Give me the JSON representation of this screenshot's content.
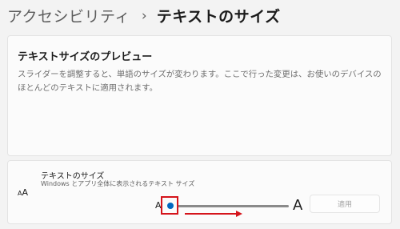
{
  "breadcrumb": {
    "parent": "アクセシビリティ",
    "separator": "›",
    "current": "テキストのサイズ"
  },
  "preview": {
    "title": "テキストサイズのプレビュー",
    "body": "スライダーを調整すると、単語のサイズが変わります。ここで行った変更は、お使いのデバイスのほとんどのテキストに適用されます。"
  },
  "text_size": {
    "icon_small": "A",
    "icon_big": "A",
    "title": "テキストのサイズ",
    "subtitle": "Windows とアプリ全体に表示されるテキスト サイズ",
    "slider_min_label": "A",
    "slider_max_label": "A",
    "slider_value_percent": 100,
    "apply_label": "適用",
    "apply_enabled": false
  },
  "colors": {
    "accent": "#0067c0",
    "highlight": "#d5141b",
    "track": "#8a8a8a"
  }
}
